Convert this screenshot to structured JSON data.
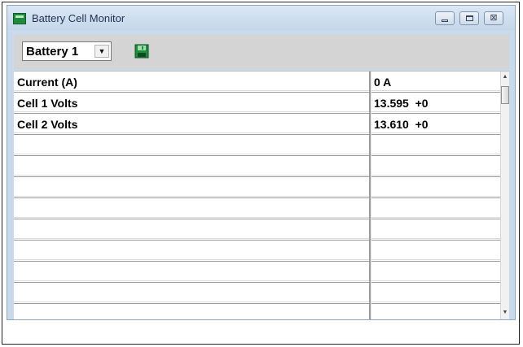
{
  "window": {
    "title": "Battery Cell Monitor",
    "icon": "battery-monitor-app-icon",
    "controls": {
      "minimize": "minimize-icon",
      "maximize": "maximize-icon",
      "close": "close-icon",
      "close_glyph": "⊠"
    }
  },
  "toolbar": {
    "battery_select": {
      "selected": "Battery 1",
      "arrow": "▼"
    },
    "save_icon": "save-disk-icon"
  },
  "grid": {
    "rows": [
      {
        "label": "Current (A)",
        "value": "0 A"
      },
      {
        "label": "Cell 1 Volts",
        "value": "13.595  +0"
      },
      {
        "label": "Cell 2 Volts",
        "value": "13.610  +0"
      }
    ]
  },
  "scrollbar": {
    "up": "▲",
    "down": "▼"
  },
  "colors": {
    "titlebar": "#c9daec",
    "toolbar": "#d4d4d4",
    "grid_line": "#9b9b9b",
    "app_icon": "#1d8a3c"
  }
}
